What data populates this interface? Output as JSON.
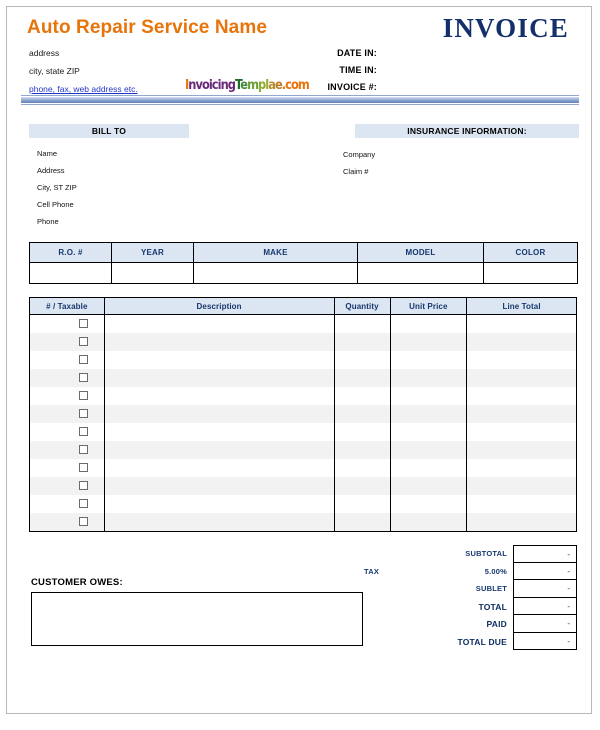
{
  "header": {
    "company_name": "Auto Repair Service Name",
    "address_line1": "address",
    "address_line2": "city, state ZIP",
    "contact_link": "phone, fax, web address etc.",
    "invoice_title": "INVOICE",
    "meta": [
      {
        "label": "DATE IN:"
      },
      {
        "label": "TIME IN:"
      },
      {
        "label": "INVOICE #:"
      }
    ],
    "logo": {
      "parts": [
        {
          "text": "I",
          "color": "#e8740c"
        },
        {
          "text": "nvoicing",
          "color": "#6b2a7a"
        },
        {
          "text": "T",
          "color": "#1f6b2e"
        },
        {
          "text": "e",
          "color": "#3f8c3a"
        },
        {
          "text": "m",
          "color": "#6a9f36"
        },
        {
          "text": "p",
          "color": "#8aad33"
        },
        {
          "text": "l",
          "color": "#a3a832"
        },
        {
          "text": "a",
          "color": "#b58f2c"
        },
        {
          "text": "e",
          "color": "#c07d28"
        },
        {
          "text": ".com",
          "color": "#e8740c"
        }
      ]
    }
  },
  "bill_to": {
    "heading": "BILL TO",
    "fields": [
      "Name",
      "Address",
      "City, ST ZIP",
      "Cell Phone",
      "Phone"
    ]
  },
  "insurance": {
    "heading": "INSURANCE INFORMATION:",
    "fields": [
      "Company",
      "Claim #"
    ]
  },
  "vehicle_table": {
    "columns": [
      "R.O. #",
      "YEAR",
      "MAKE",
      "MODEL",
      "COLOR"
    ],
    "row": [
      "",
      "",
      "",
      "",
      ""
    ]
  },
  "items_table": {
    "columns": [
      "# / Taxable",
      "Description",
      "Quantity",
      "Unit Price",
      "Line Total"
    ],
    "row_count": 12,
    "rows": [
      {
        "taxable_checked": false,
        "description": "",
        "quantity": "",
        "unit_price": "",
        "line_total": ""
      },
      {
        "taxable_checked": false,
        "description": "",
        "quantity": "",
        "unit_price": "",
        "line_total": ""
      },
      {
        "taxable_checked": false,
        "description": "",
        "quantity": "",
        "unit_price": "",
        "line_total": ""
      },
      {
        "taxable_checked": false,
        "description": "",
        "quantity": "",
        "unit_price": "",
        "line_total": ""
      },
      {
        "taxable_checked": false,
        "description": "",
        "quantity": "",
        "unit_price": "",
        "line_total": ""
      },
      {
        "taxable_checked": false,
        "description": "",
        "quantity": "",
        "unit_price": "",
        "line_total": ""
      },
      {
        "taxable_checked": false,
        "description": "",
        "quantity": "",
        "unit_price": "",
        "line_total": ""
      },
      {
        "taxable_checked": false,
        "description": "",
        "quantity": "",
        "unit_price": "",
        "line_total": ""
      },
      {
        "taxable_checked": false,
        "description": "",
        "quantity": "",
        "unit_price": "",
        "line_total": ""
      },
      {
        "taxable_checked": false,
        "description": "",
        "quantity": "",
        "unit_price": "",
        "line_total": ""
      },
      {
        "taxable_checked": false,
        "description": "",
        "quantity": "",
        "unit_price": "",
        "line_total": ""
      },
      {
        "taxable_checked": false,
        "description": "",
        "quantity": "",
        "unit_price": "",
        "line_total": ""
      }
    ]
  },
  "totals": {
    "tax_word": "TAX",
    "rows": [
      {
        "label": "SUBTOTAL",
        "value": "-",
        "strong": false
      },
      {
        "label": "5.00%",
        "value": "-",
        "strong": false
      },
      {
        "label": "SUBLET",
        "value": "-",
        "strong": false
      },
      {
        "label": "TOTAL",
        "value": "-",
        "strong": true
      },
      {
        "label": "PAID",
        "value": "-",
        "strong": true
      },
      {
        "label": "TOTAL DUE",
        "value": "-",
        "strong": true
      }
    ]
  },
  "customer_owes": {
    "label": "CUSTOMER OWES:",
    "value": ""
  },
  "colors": {
    "brand_orange": "#e8740c",
    "navy": "#13306b",
    "header_fill": "#dce6f2",
    "link_blue": "#2435c8",
    "row_stripe": "#f2f2f2"
  }
}
